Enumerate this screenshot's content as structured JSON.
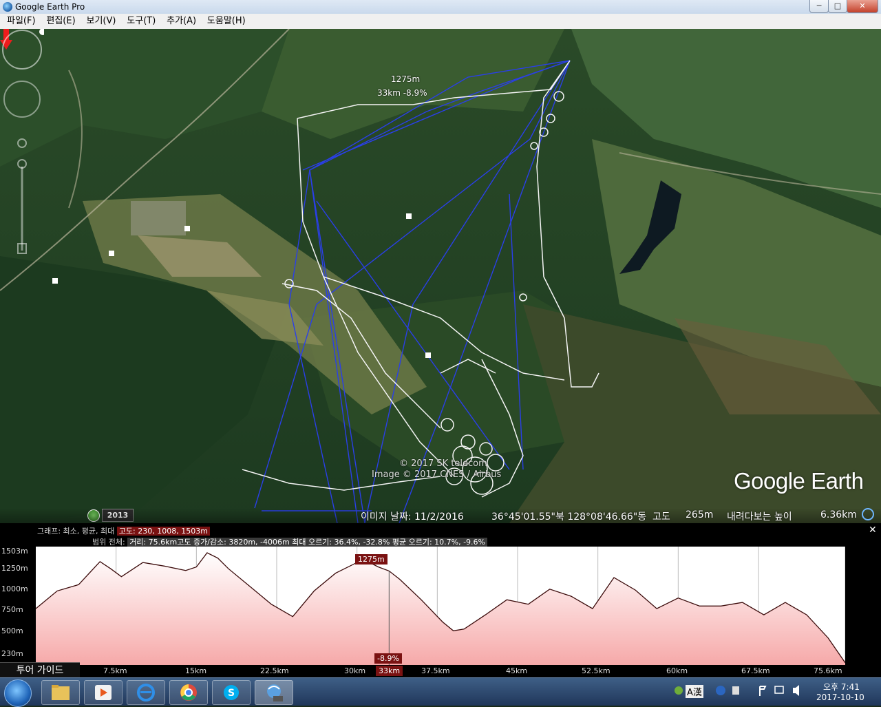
{
  "window": {
    "title": "Google Earth Pro",
    "min": "─",
    "max": "□",
    "close": "✕"
  },
  "menu": [
    "파일(F)",
    "편집(E)",
    "보기(V)",
    "도구(T)",
    "추가(A)",
    "도움말(H)"
  ],
  "map": {
    "marker_altitude": "1275m",
    "marker_info": "33km  -8.9%",
    "copyright_1": "© 2017 SK telecom",
    "copyright_2": "Image © 2017 CNES / Airbus",
    "logo": "Google Earth",
    "year": "2013",
    "status": {
      "image_date": "이미지 날짜: 11/2/2016",
      "coords": "36°45'01.55\"북  128°08'46.66\"동",
      "elev_label": "고도",
      "elev_value": "265m",
      "eye_label": "내려다보는 높이",
      "eye_value": "6.36km"
    }
  },
  "profile": {
    "graph_label": "그래프: 최소, 평균, 최대",
    "graph_values": "고도: 230, 1008, 1503m",
    "range_label": "범위 전체:",
    "range_values": "거리: 75.6km고도 증가/감소: 3820m, -4006m 최대 오르기: 36.4%, -32.8% 평균 오르기: 10.7%, -9.6%",
    "close": "✕",
    "y_ticks": [
      "1503m",
      "1250m",
      "1000m",
      "750m",
      "500m",
      "230m"
    ],
    "x_ticks": [
      "7.5km",
      "15km",
      "22.5km",
      "30km",
      "37.5km",
      "45km",
      "52.5km",
      "60km",
      "67.5km",
      "75.6km"
    ],
    "cursor_altitude": "1275m",
    "cursor_slope": "-8.9%",
    "cursor_distance": "33km",
    "tour_guide": "투어 가이드"
  },
  "chart_data": {
    "type": "area",
    "ylabel": "",
    "xlabel": "",
    "x_unit": "km",
    "y_unit": "m",
    "ylim": [
      230,
      1503
    ],
    "xlim": [
      0,
      75.6
    ],
    "x": [
      0,
      2,
      4,
      6,
      7,
      8,
      10,
      12,
      14,
      15,
      16,
      17,
      18,
      20,
      22,
      24,
      26,
      28,
      30,
      31,
      32,
      33,
      34,
      36,
      38,
      39,
      40,
      42,
      44,
      46,
      48,
      50,
      52,
      54,
      56,
      58,
      60,
      62,
      64,
      66,
      68,
      70,
      72,
      74,
      75.6
    ],
    "series": [
      {
        "values": [
          850,
          1050,
          1120,
          1380,
          1300,
          1210,
          1370,
          1330,
          1280,
          1320,
          1480,
          1420,
          1300,
          1100,
          900,
          760,
          1050,
          1250,
          1370,
          1380,
          1320,
          1275,
          1180,
          950,
          700,
          600,
          620,
          780,
          950,
          900,
          1070,
          990,
          850,
          1200,
          1060,
          850,
          970,
          880,
          880,
          920,
          780,
          920,
          780,
          520,
          240
        ]
      }
    ],
    "cursor": {
      "x": 33,
      "y": 1275,
      "slope": "-8.9%"
    }
  },
  "taskbar": {
    "apps": [
      "file-explorer",
      "media-player",
      "internet-explorer",
      "chrome",
      "skype",
      "google-earth-pro"
    ],
    "tray_ime": "A漢",
    "time": "오후 7:41",
    "date": "2017-10-10"
  }
}
